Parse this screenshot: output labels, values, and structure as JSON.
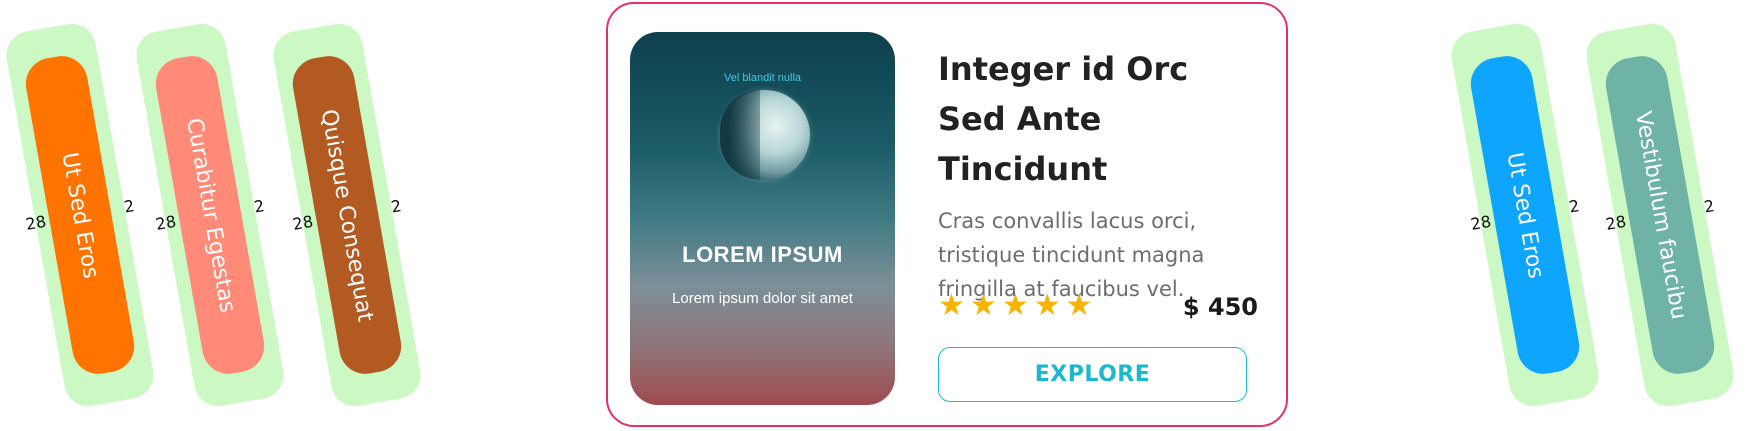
{
  "side_cards_left": [
    {
      "label": "Ut Sed Eros",
      "color": "#ff7300",
      "num_left": "28",
      "num_right": "2"
    },
    {
      "label": "Curabitur Egestas",
      "color": "#ff8a78",
      "num_left": "28",
      "num_right": "2"
    },
    {
      "label": "Quisque Consequat",
      "color": "#b35a22",
      "num_left": "28",
      "num_right": "2"
    }
  ],
  "side_cards_right": [
    {
      "label": "Ut Sed Eros",
      "color": "#0ea5ff",
      "num_left": "28",
      "num_right": "2"
    },
    {
      "label": "Vestibulum faucibu",
      "color": "#6fb3a6",
      "num_left": "28",
      "num_right": "2"
    }
  ],
  "product": {
    "cover_kicker": "Vel blandit nulla",
    "cover_title": "LOREM IPSUM",
    "cover_subtitle": "Lorem ipsum dolor sit amet",
    "title": "Integer id Orc Sed Ante Tincidunt",
    "description": "Cras convallis lacus orci, tristique tincidunt magna fringilla at faucibus vel.",
    "rating": 5,
    "rating_max": 5,
    "price": "$ 450",
    "cta_label": "EXPLORE",
    "accent_color": "#e5306c",
    "cta_color": "#1ab7cf",
    "star_color": "#f7b400"
  }
}
